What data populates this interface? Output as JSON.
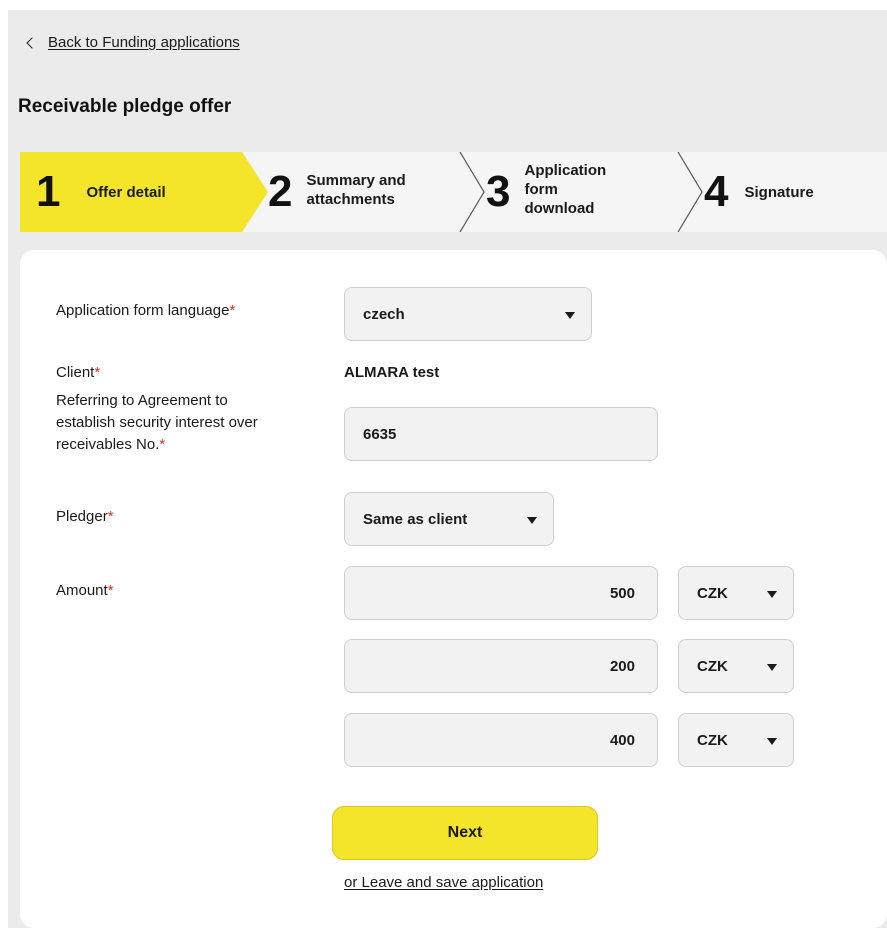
{
  "nav": {
    "back_label": "Back to Funding applications"
  },
  "page": {
    "title": "Receivable pledge offer"
  },
  "stepper": {
    "accent_color": "#f4e42a",
    "steps": [
      {
        "number": "1",
        "label_line1": "Offer detail",
        "label_line2": "",
        "label_line3": "",
        "active": true
      },
      {
        "number": "2",
        "label_line1": "Summary and",
        "label_line2": "attachments",
        "label_line3": "",
        "active": false
      },
      {
        "number": "3",
        "label_line1": "Application",
        "label_line2": "form",
        "label_line3": "download",
        "active": false
      },
      {
        "number": "4",
        "label_line1": "Signature",
        "label_line2": "",
        "label_line3": "",
        "active": false
      }
    ]
  },
  "form": {
    "required_mark": "*",
    "language": {
      "label": "Application form language",
      "value": "czech"
    },
    "client": {
      "label": "Client",
      "value": "ALMARA test"
    },
    "agreement": {
      "label_line1": "Referring to Agreement to",
      "label_line2": "establish security interest over",
      "label_line3": "receivables No.",
      "value": "6635"
    },
    "pledger": {
      "label": "Pledger",
      "value": "Same as client"
    },
    "amount": {
      "label": "Amount",
      "rows": [
        {
          "value": "500",
          "currency": "CZK"
        },
        {
          "value": "200",
          "currency": "CZK"
        },
        {
          "value": "400",
          "currency": "CZK"
        }
      ]
    }
  },
  "actions": {
    "next_label": "Next",
    "leave_label": "or Leave and save application"
  }
}
